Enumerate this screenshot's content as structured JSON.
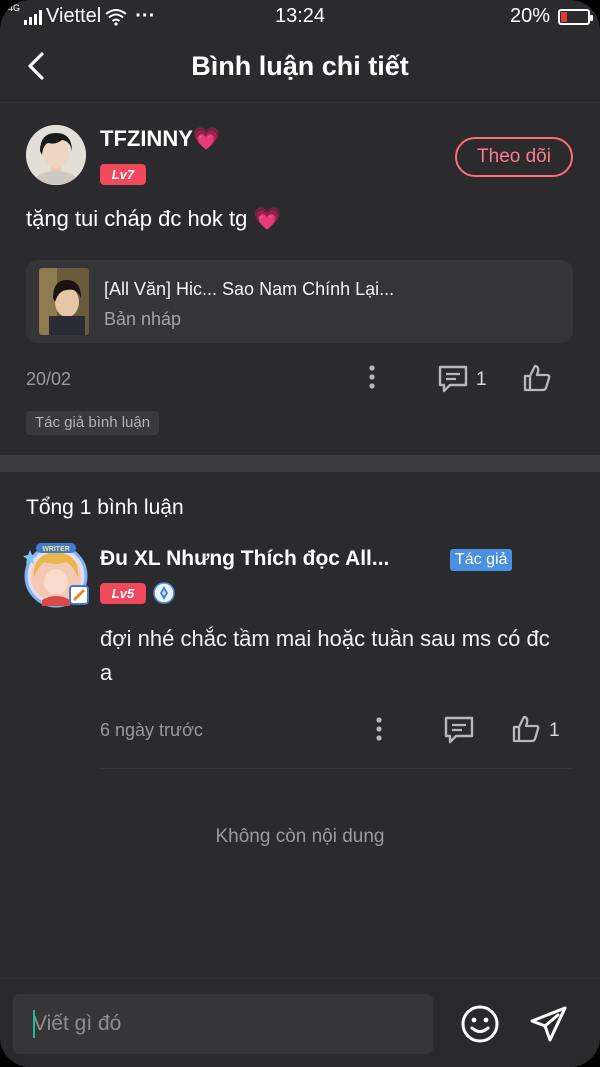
{
  "status_bar": {
    "network_type": "4G",
    "carrier": "Viettel",
    "more": "···",
    "time": "13:24",
    "battery": "20%",
    "battery_level": 0.2
  },
  "header": {
    "title": "Bình luận chi tiết"
  },
  "post": {
    "username": "TFZINNY💗",
    "level": "Lv7",
    "follow_label": "Theo dõi",
    "content": "tặng tui cháp đc hok tg 💗",
    "story": {
      "title": "[All Văn] Hic... Sao Nam Chính Lại...",
      "subtitle": "Bản nháp"
    },
    "date": "20/02",
    "comment_count": "1",
    "author_tag": "Tác giả bình luận"
  },
  "comments_section": {
    "total_label": "Tổng 1 bình luận",
    "comments": [
      {
        "name": "Đu XL Nhưng Thích đọc All...",
        "author_badge": "Tác giả",
        "avatar_frame_text": "WRITER",
        "level": "Lv5",
        "text": "đợi nhé chắc tầm mai hoặc tuần sau ms có đc a",
        "date": "6 ngày trước",
        "like_count": "1"
      }
    ],
    "end_label": "Không còn nội dung"
  },
  "composer": {
    "placeholder": "Viết gì đó"
  },
  "colors": {
    "background": "#2b2b2d",
    "accent": "#f0485d",
    "follow": "#ff7b8c",
    "author_badge": "#4a90e2",
    "caret": "#1db9a3"
  },
  "icons": [
    "back-icon",
    "more-icon",
    "comment-icon",
    "like-icon",
    "emoji-icon",
    "send-icon",
    "verified-icon",
    "wifi-icon",
    "signal-icon",
    "battery-icon"
  ]
}
